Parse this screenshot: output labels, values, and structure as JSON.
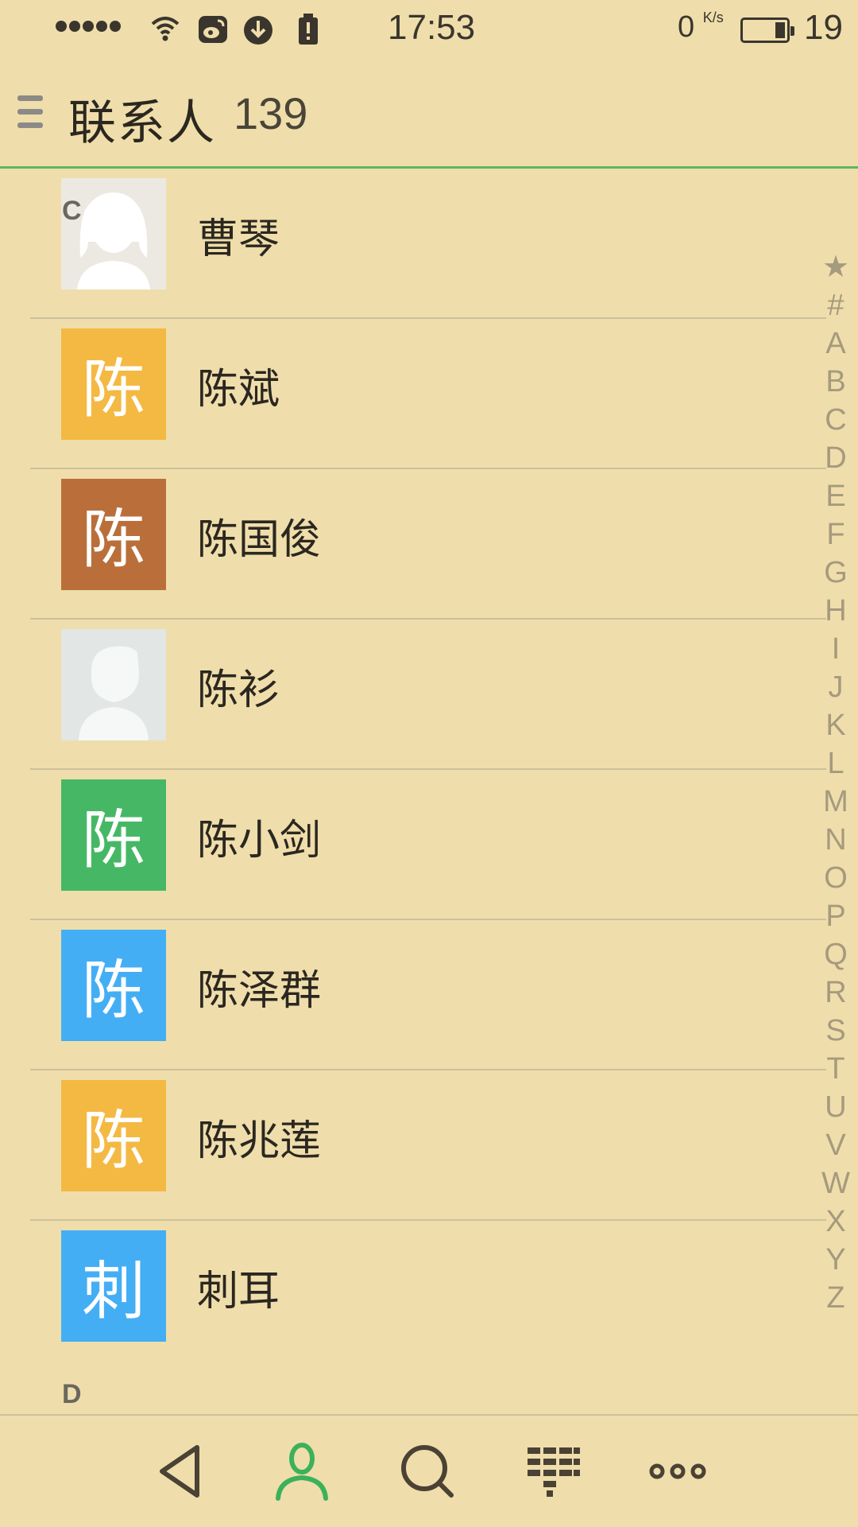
{
  "status_bar": {
    "time": "17:53",
    "net_speed": "0",
    "net_unit": "K/s",
    "battery_level": "19"
  },
  "header": {
    "title": "联系人",
    "count": "139"
  },
  "contacts": [
    {
      "section": "C",
      "name": "曹琴",
      "avatar_type": "photo-female",
      "avatar_char": "",
      "avatar_color": ""
    },
    {
      "name": "陈斌",
      "avatar_type": "letter",
      "avatar_char": "陈",
      "avatar_color": "#f4b942"
    },
    {
      "name": "陈国俊",
      "avatar_type": "letter",
      "avatar_char": "陈",
      "avatar_color": "#ba6f3b"
    },
    {
      "name": "陈衫",
      "avatar_type": "photo-male",
      "avatar_char": "",
      "avatar_color": ""
    },
    {
      "name": "陈小剑",
      "avatar_type": "letter",
      "avatar_char": "陈",
      "avatar_color": "#46b865"
    },
    {
      "name": "陈泽群",
      "avatar_type": "letter",
      "avatar_char": "陈",
      "avatar_color": "#44aef5"
    },
    {
      "name": "陈兆莲",
      "avatar_type": "letter",
      "avatar_char": "陈",
      "avatar_color": "#f4b942"
    },
    {
      "name": "刺耳",
      "avatar_type": "letter",
      "avatar_char": "刺",
      "avatar_color": "#44aef5"
    }
  ],
  "next_section": "D",
  "alpha_index": [
    "★",
    "#",
    "A",
    "B",
    "C",
    "D",
    "E",
    "F",
    "G",
    "H",
    "I",
    "J",
    "K",
    "L",
    "M",
    "N",
    "O",
    "P",
    "Q",
    "R",
    "S",
    "T",
    "U",
    "V",
    "W",
    "X",
    "Y",
    "Z"
  ],
  "bottom_nav": [
    {
      "icon": "back-triangle-icon"
    },
    {
      "icon": "contacts-person-icon",
      "active": true,
      "color": "#3cb15a"
    },
    {
      "icon": "search-icon"
    },
    {
      "icon": "dialpad-icon"
    },
    {
      "icon": "more-dots-icon"
    }
  ]
}
